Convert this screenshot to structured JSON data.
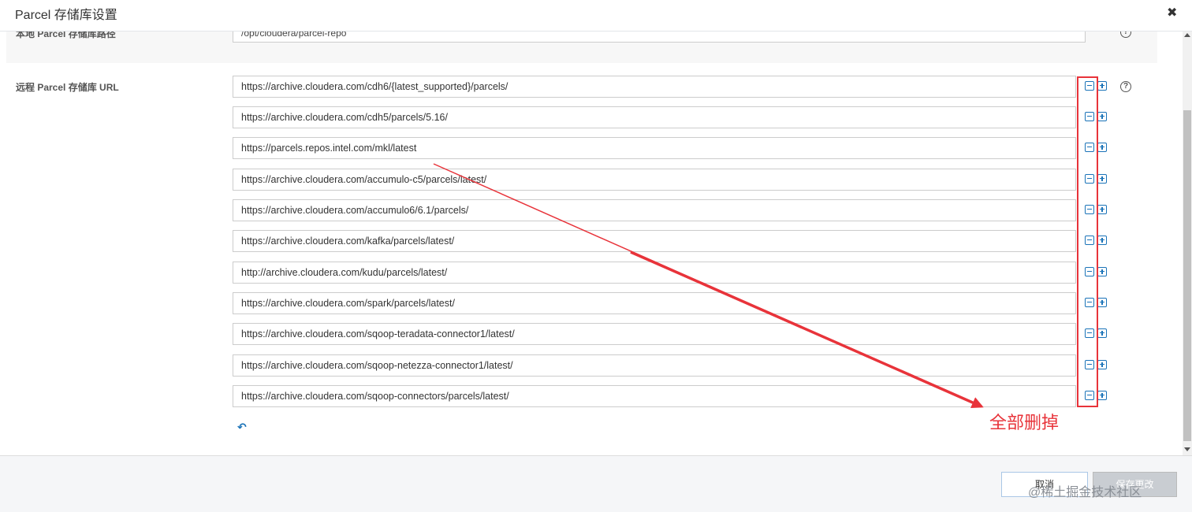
{
  "dialog": {
    "title": "Parcel 存储库设置",
    "close_label": "✖"
  },
  "local_repo": {
    "label": "本地 Parcel 存储库路径",
    "value": "/opt/cloudera/parcel-repo"
  },
  "remote_repo": {
    "label": "远程 Parcel 存储库 URL",
    "urls": [
      "https://archive.cloudera.com/cdh6/{latest_supported}/parcels/",
      "https://archive.cloudera.com/cdh5/parcels/5.16/",
      "https://parcels.repos.intel.com/mkl/latest",
      "https://archive.cloudera.com/accumulo-c5/parcels/latest/",
      "https://archive.cloudera.com/accumulo6/6.1/parcels/",
      "https://archive.cloudera.com/kafka/parcels/latest/",
      "http://archive.cloudera.com/kudu/parcels/latest/",
      "https://archive.cloudera.com/spark/parcels/latest/",
      "https://archive.cloudera.com/sqoop-teradata-connector1/latest/",
      "https://archive.cloudera.com/sqoop-netezza-connector1/latest/",
      "https://archive.cloudera.com/sqoop-connectors/parcels/latest/"
    ]
  },
  "icons": {
    "help": "?",
    "undo": "↶",
    "remove": "minus-icon",
    "add": "plus-icon"
  },
  "annotation": {
    "text": "全部删掉",
    "color": "#e8333a"
  },
  "footer": {
    "cancel_label": "取消",
    "save_label": "保存更改",
    "watermark": "@稀土掘金技术社区"
  }
}
